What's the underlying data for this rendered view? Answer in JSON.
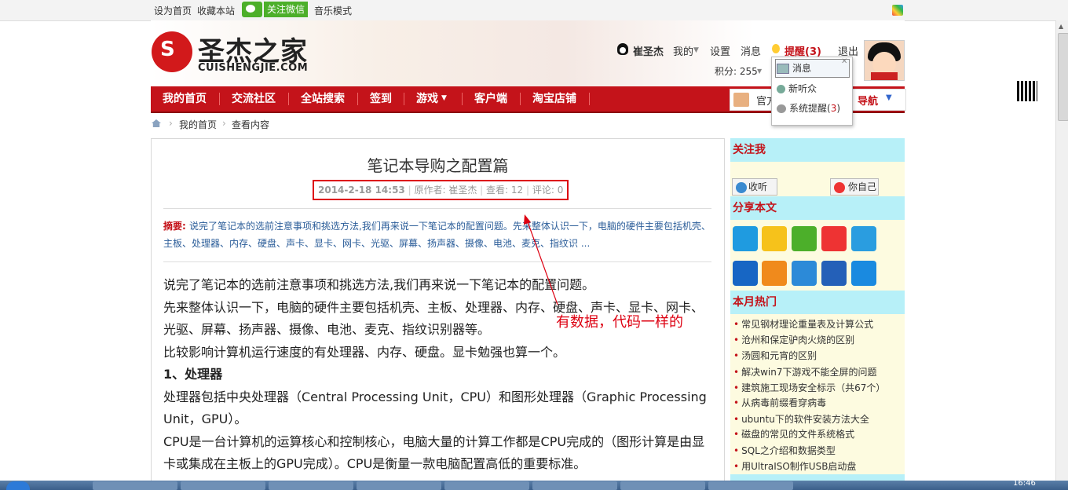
{
  "topbar": {
    "set_home": "设为首页",
    "bookmark": "收藏本站",
    "follow_wechat": "关注微信",
    "music_mode": "音乐模式"
  },
  "logo": {
    "text_cn": "圣杰之家",
    "text_en": "CUISHENGJIE.COM",
    "mark": "S"
  },
  "user": {
    "name": "崔圣杰",
    "my": "我的",
    "settings": "设置",
    "messages": "消息",
    "reminders": "提醒(3)",
    "logout": "退出",
    "points": "积分: 255"
  },
  "nav": {
    "items": [
      "我的首页",
      "交流社区",
      "全站搜索",
      "签到",
      "游戏",
      "客户端",
      "淘宝店铺"
    ],
    "right_text1": "官方",
    "right_text2": "导航"
  },
  "dropdown": {
    "items": [
      "消息",
      "新听众",
      "系统提醒"
    ],
    "count": "3"
  },
  "breadcrumb": {
    "home": "我的首页",
    "current": "查看内容"
  },
  "article": {
    "title": "笔记本导购之配置篇",
    "date": "2014-2-18 14:53",
    "author": "原作者: 崔圣杰",
    "views": "查看: 12",
    "comments": "评论: 0",
    "summary_label": "摘要",
    "summary": "说完了笔记本的选前注意事项和挑选方法,我们再来说一下笔记本的配置问题。先来整体认识一下，电脑的硬件主要包括机壳、主板、处理器、内存、硬盘、声卡、显卡、网卡、光驱、屏幕、扬声器、摄像、电池、麦克、指纹识 ...",
    "p1": "说完了笔记本的选前注意事项和挑选方法,我们再来说一下笔记本的配置问题。",
    "p2": "先来整体认识一下，电脑的硬件主要包括机壳、主板、处理器、内存、硬盘、声卡、显卡、网卡、光驱、屏幕、扬声器、摄像、电池、麦克、指纹识别器等。",
    "p3": "比较影响计算机运行速度的有处理器、内存、硬盘。显卡勉强也算一个。",
    "h1": "1、处理器",
    "p4": "处理器包括中央处理器（Central Processing Unit，CPU）和图形处理器（Graphic Processing Unit，GPU）。",
    "p5": "CPU是一台计算机的运算核心和控制核心，电脑大量的计算工作都是CPU完成的（图形计算是由显卡或集成在主板上的GPU完成）。CPU是衡量一款电脑配置高低的重要标准。"
  },
  "annotation": "有数据，代码一样的",
  "sidebar": {
    "follow_title": "关注我",
    "listen_btn": "收听",
    "weibo_btn": "你自己",
    "share_title": "分享本文",
    "hot_title": "本月热门",
    "hot_items": [
      "常见钢材理论重量表及计算公式",
      "沧州和保定驴肉火烧的区别",
      "汤圆和元宵的区别",
      "解决win7下游戏不能全屏的问题",
      "建筑施工现场安全标示（共67个）",
      "从病毒前缀看穿病毒",
      "ubuntu下的软件安装方法大全",
      "磁盘的常见的文件系统格式",
      "SQL之介绍和数据类型",
      "用UltraISO制作USB启动盘"
    ]
  },
  "taskbar": {
    "clock": "16:46"
  }
}
